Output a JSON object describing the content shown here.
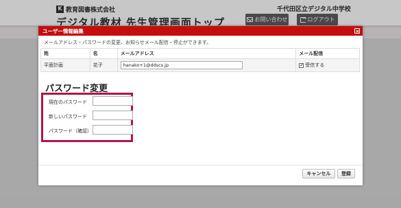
{
  "background": {
    "company": "教育図書株式会社",
    "page_title": "デジタル教材 先生管理画面トップ",
    "school": "千代田区立デジタル中学校",
    "inquiry_label": "お問い合わせ",
    "logout_label": "ログアウト"
  },
  "modal": {
    "title": "ユーザー情報編集",
    "description": "メールアドレス・パスワードの変更、お知らせメール配信・停止ができます。",
    "table": {
      "headers": [
        "姓",
        "名",
        "メールアドレス",
        "メール配信"
      ],
      "row": {
        "last_name": "平面計画",
        "first_name": "花子",
        "email": "hanako+1@ddscs.jp",
        "mail_label": "受信する",
        "mail_checked": true
      }
    },
    "password": {
      "heading": "パスワード変更",
      "current_label": "現在のパスワード",
      "new_label": "新しいパスワード",
      "confirm_label": "パスワード（確認）"
    },
    "buttons": {
      "cancel": "キャンセル",
      "register": "登録"
    }
  },
  "colors": {
    "header_red": "#c40d0d",
    "highlight": "#b0124e"
  }
}
